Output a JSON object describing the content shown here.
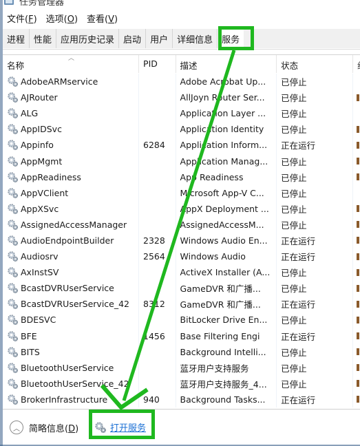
{
  "window": {
    "title": "任务管理器"
  },
  "menu": [
    {
      "label": "文件(",
      "key": "F",
      "suffix": ")"
    },
    {
      "label": "选项(",
      "key": "O",
      "suffix": ")"
    },
    {
      "label": "查看(",
      "key": "V",
      "suffix": ")"
    }
  ],
  "tabs": [
    {
      "label": "进程"
    },
    {
      "label": "性能"
    },
    {
      "label": "应用历史记录"
    },
    {
      "label": "启动"
    },
    {
      "label": "用户"
    },
    {
      "label": "详细信息"
    },
    {
      "label": "服务",
      "active": true
    }
  ],
  "columns": {
    "name": "名称",
    "pid": "PID",
    "desc": "描述",
    "status": "状态",
    "group": "组"
  },
  "services": [
    {
      "name": "AdobeARMservice",
      "pid": "",
      "desc": "Adobe Acrobat Up...",
      "status": "已停止",
      "group": false
    },
    {
      "name": "AJRouter",
      "pid": "",
      "desc": "AllJoyn Router Ser...",
      "status": "已停止",
      "group": true
    },
    {
      "name": "ALG",
      "pid": "",
      "desc": "Application Layer ...",
      "status": "已停止",
      "group": false
    },
    {
      "name": "AppIDSvc",
      "pid": "",
      "desc": "Application Identity",
      "status": "已停止",
      "group": true
    },
    {
      "name": "Appinfo",
      "pid": "6284",
      "desc": "Application Inform...",
      "status": "正在运行",
      "group": true
    },
    {
      "name": "AppMgmt",
      "pid": "",
      "desc": "Application Manag...",
      "status": "已停止",
      "group": true
    },
    {
      "name": "AppReadiness",
      "pid": "",
      "desc": "App Readiness",
      "status": "已停止",
      "group": true
    },
    {
      "name": "AppVClient",
      "pid": "",
      "desc": "Microsoft App-V C...",
      "status": "已停止",
      "group": false
    },
    {
      "name": "AppXSvc",
      "pid": "",
      "desc": "AppX Deployment ...",
      "status": "已停止",
      "group": true
    },
    {
      "name": "AssignedAccessManager",
      "pid": "",
      "desc": "AssignedAccessM...",
      "status": "已停止",
      "group": true
    },
    {
      "name": "AudioEndpointBuilder",
      "pid": "2328",
      "desc": "Windows Audio En...",
      "status": "正在运行",
      "group": true
    },
    {
      "name": "Audiosrv",
      "pid": "2564",
      "desc": "Windows Audio",
      "status": "正在运行",
      "group": true
    },
    {
      "name": "AxInstSV",
      "pid": "",
      "desc": "ActiveX Installer (A...",
      "status": "已停止",
      "group": true
    },
    {
      "name": "BcastDVRUserService",
      "pid": "",
      "desc": "GameDVR 和广播...",
      "status": "已停止",
      "group": true
    },
    {
      "name": "BcastDVRUserService_42",
      "pid": "8312",
      "desc": "GameDVR 和广播...",
      "status": "正在运行",
      "group": true
    },
    {
      "name": "BDESVC",
      "pid": "",
      "desc": "BitLocker Drive En...",
      "status": "已停止",
      "group": true
    },
    {
      "name": "BFE",
      "pid": "1456",
      "desc": "Base Filtering Engi",
      "status": "正在运行",
      "group": true
    },
    {
      "name": "BITS",
      "pid": "",
      "desc": "Background Intelli...",
      "status": "已停止",
      "group": true
    },
    {
      "name": "BluetoothUserService",
      "pid": "",
      "desc": "蓝牙用户支持服务",
      "status": "已停止",
      "group": true
    },
    {
      "name": "BluetoothUserService_42",
      "pid": "",
      "desc": "蓝牙用户支持服务_4...",
      "status": "已停止",
      "group": true
    },
    {
      "name": "BrokerInfrastructure",
      "pid": "940",
      "desc": "Background Tasks...",
      "status": "正在运行",
      "group": true
    }
  ],
  "footer": {
    "fewer_details_label": "简略信息(",
    "fewer_details_key": "D",
    "fewer_details_suffix": ")",
    "open_services_label": "打开服务"
  },
  "annotation": {
    "highlight_color": "#1fb81f"
  }
}
